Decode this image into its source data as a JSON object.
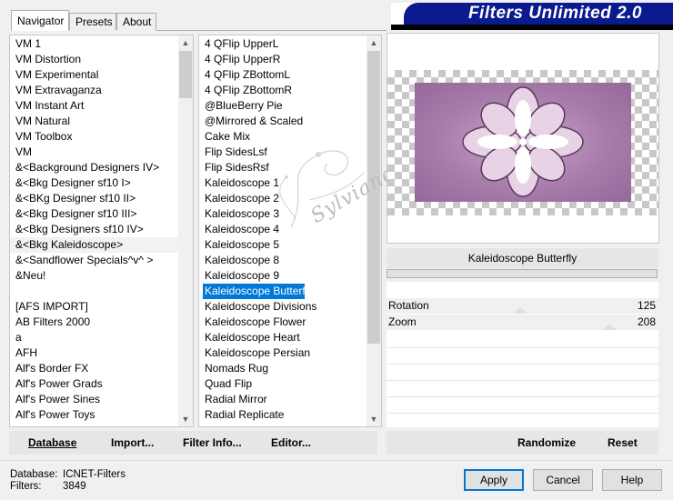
{
  "tabs": [
    {
      "label": "Navigator",
      "active": true
    },
    {
      "label": "Presets",
      "active": false
    },
    {
      "label": "About",
      "active": false
    }
  ],
  "banner_title": "Filters Unlimited 2.0",
  "categories": [
    "VM 1",
    "VM Distortion",
    "VM Experimental",
    "VM Extravaganza",
    "VM Instant Art",
    "VM Natural",
    "VM Toolbox",
    "VM",
    "&<Background Designers IV>",
    "&<Bkg Designer sf10 I>",
    "&<BKg Designer sf10 II>",
    "&<Bkg Designer sf10 III>",
    "&<Bkg Designers sf10 IV>",
    "&<Bkg Kaleidoscope>",
    "&<Sandflower Specials^v^ >",
    "&Neu!",
    "",
    "[AFS IMPORT]",
    "AB Filters 2000",
    "a",
    "AFH",
    "Alf's Border FX",
    "Alf's Power Grads",
    "Alf's Power Sines",
    "Alf's Power Toys"
  ],
  "categories_highlight_index": 13,
  "filters": [
    "4 QFlip UpperL",
    "4 QFlip UpperR",
    "4 QFlip ZBottomL",
    "4 QFlip ZBottomR",
    "@BlueBerry Pie",
    "@Mirrored & Scaled",
    "Cake Mix",
    "Flip SidesLsf",
    "Flip SidesRsf",
    "Kaleidoscope 1",
    "Kaleidoscope 2",
    "Kaleidoscope 3",
    "Kaleidoscope 4",
    "Kaleidoscope 5",
    "Kaleidoscope 8",
    "Kaleidoscope 9",
    "Kaleidoscope Butterfly",
    "Kaleidoscope Divisions",
    "Kaleidoscope Flower",
    "Kaleidoscope Heart",
    "Kaleidoscope Persian",
    "Nomads Rug",
    "Quad Flip",
    "Radial Mirror",
    "Radial Replicate"
  ],
  "filters_selected_index": 16,
  "watermark": "Sylviane",
  "selected_filter_name": "Kaleidoscope Butterfly",
  "params": [
    {
      "label": "Rotation",
      "value": "125",
      "fraction": 0.49
    },
    {
      "label": "Zoom",
      "value": "208",
      "fraction": 0.82
    }
  ],
  "left_toolbar": {
    "database": "Database",
    "import": "Import...",
    "filter_info": "Filter Info...",
    "editor": "Editor..."
  },
  "right_toolbar": {
    "randomize": "Randomize",
    "reset": "Reset"
  },
  "status": {
    "database_label": "Database:",
    "database_value": "ICNET-Filters",
    "filters_label": "Filters:",
    "filters_value": "3849"
  },
  "buttons": {
    "apply": "Apply",
    "cancel": "Cancel",
    "help": "Help"
  },
  "colors": {
    "banner": "#0b1b8f",
    "selection": "#0078d7",
    "artwork": "#a579a8"
  }
}
